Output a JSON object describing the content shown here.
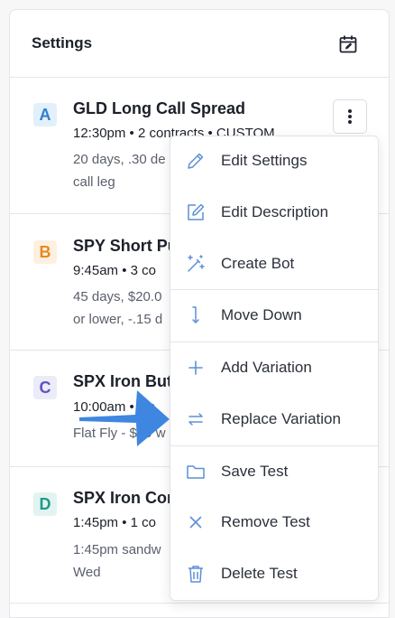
{
  "header": {
    "title": "Settings",
    "calendar_icon": "calendar-edit-icon"
  },
  "rows": [
    {
      "badge": "A",
      "title": "GLD Long Call Spread",
      "meta": "12:30pm • 2 contracts • CUSTOM",
      "desc1": "20 days, .30 de",
      "desc2": "call leg",
      "badge_bg": "#e3f0fb",
      "badge_fg": "#2f7fd1"
    },
    {
      "badge": "B",
      "title": "SPY Short Pu",
      "meta": "9:45am • 3 co",
      "desc1": "45 days, $20.0",
      "desc2": "or lower, -.15 d",
      "badge_bg": "#fdf0e1",
      "badge_fg": "#e88a1f"
    },
    {
      "badge": "C",
      "title": "SPX Iron But",
      "meta": "10:00am • Up",
      "desc1": "Flat Fly - $10 w",
      "desc2": "",
      "badge_bg": "#ecebf8",
      "badge_fg": "#5b53c2"
    },
    {
      "badge": "D",
      "title": "SPX Iron Cor",
      "meta": "1:45pm • 1 co",
      "desc1": "1:45pm sandw",
      "desc2": "Wed",
      "badge_bg": "#e2f4f1",
      "badge_fg": "#1f9a86"
    }
  ],
  "menu": {
    "items": [
      {
        "label": "Edit Settings",
        "icon": "pencil-icon"
      },
      {
        "label": "Edit Description",
        "icon": "edit-square-icon"
      },
      {
        "label": "Create Bot",
        "icon": "magic-wand-icon"
      },
      {
        "label": "Move Down",
        "icon": "arrow-down-icon"
      },
      {
        "label": "Add Variation",
        "icon": "plus-icon"
      },
      {
        "label": "Replace Variation",
        "icon": "swap-arrows-icon"
      },
      {
        "label": "Save Test",
        "icon": "folder-icon"
      },
      {
        "label": "Remove Test",
        "icon": "x-icon"
      },
      {
        "label": "Delete Test",
        "icon": "trash-icon"
      }
    ]
  },
  "colors": {
    "icon": "#5b8fd6",
    "arrow": "#3f86e0"
  }
}
